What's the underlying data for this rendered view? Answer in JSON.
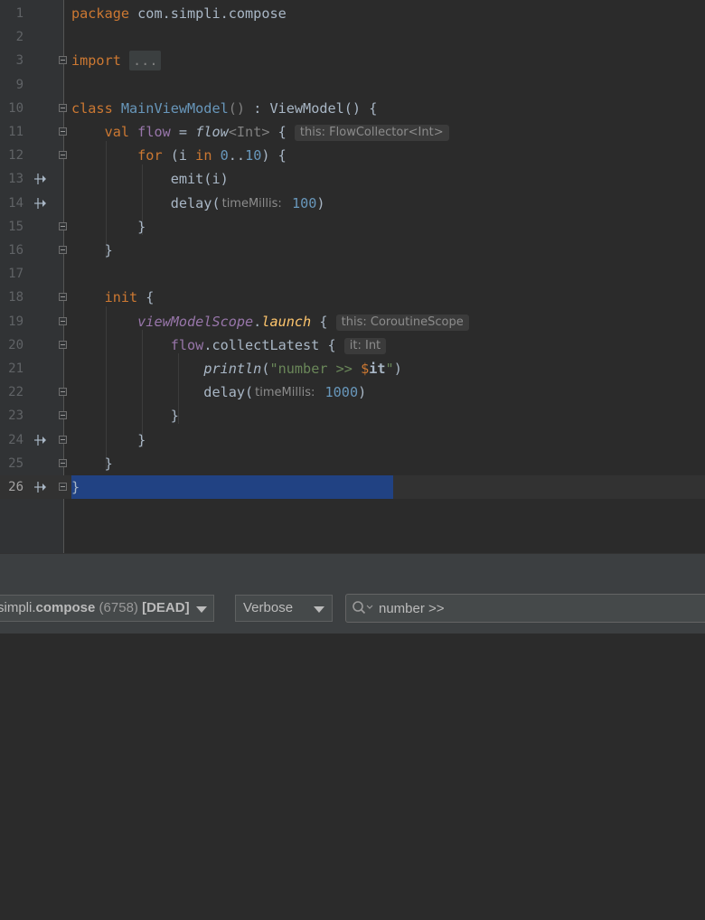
{
  "editor": {
    "lines": [
      {
        "num": "1",
        "tokens": [
          {
            "t": "package",
            "c": "kw"
          },
          {
            "t": " com.simpli.compose"
          }
        ]
      },
      {
        "num": "2",
        "tokens": []
      },
      {
        "num": "3",
        "tokens": [
          {
            "t": "import",
            "c": "kw"
          },
          {
            "t": " "
          },
          {
            "t": "...",
            "c": "ellipsis"
          }
        ]
      },
      {
        "num": "9",
        "tokens": []
      },
      {
        "num": "10",
        "tokens": [
          {
            "t": "class",
            "c": "kw"
          },
          {
            "t": " "
          },
          {
            "t": "MainViewModel",
            "c": "cls"
          },
          {
            "t": "()",
            "c": "gray"
          },
          {
            "t": " : ViewModel() {"
          }
        ]
      },
      {
        "num": "11",
        "tokens": [
          {
            "t": "    "
          },
          {
            "t": "val",
            "c": "kw"
          },
          {
            "t": " "
          },
          {
            "t": "flow",
            "c": "prop"
          },
          {
            "t": " = "
          },
          {
            "t": "flow",
            "c": "fn-it"
          },
          {
            "t": "<Int>",
            "c": "gen"
          },
          {
            "t": " { "
          },
          {
            "t": "this: FlowCollector<Int>",
            "c": "hint"
          }
        ]
      },
      {
        "num": "12",
        "tokens": [
          {
            "t": "        "
          },
          {
            "t": "for",
            "c": "kw"
          },
          {
            "t": " (i "
          },
          {
            "t": "in",
            "c": "kw"
          },
          {
            "t": " "
          },
          {
            "t": "0",
            "c": "num"
          },
          {
            "t": ".."
          },
          {
            "t": "10",
            "c": "num"
          },
          {
            "t": ") {"
          }
        ]
      },
      {
        "num": "13",
        "tokens": [
          {
            "t": "            emit(i)"
          }
        ]
      },
      {
        "num": "14",
        "tokens": [
          {
            "t": "            delay("
          },
          {
            "t": "timeMillis:",
            "c": "hint-c"
          },
          {
            "t": " "
          },
          {
            "t": "100",
            "c": "num"
          },
          {
            "t": ")"
          }
        ]
      },
      {
        "num": "15",
        "tokens": [
          {
            "t": "        }"
          }
        ]
      },
      {
        "num": "16",
        "tokens": [
          {
            "t": "    }"
          }
        ]
      },
      {
        "num": "17",
        "tokens": []
      },
      {
        "num": "18",
        "tokens": [
          {
            "t": "    "
          },
          {
            "t": "init",
            "c": "kw"
          },
          {
            "t": " {"
          }
        ]
      },
      {
        "num": "19",
        "tokens": [
          {
            "t": "        "
          },
          {
            "t": "viewModelScope",
            "c": "prop-it"
          },
          {
            "t": "."
          },
          {
            "t": "launch",
            "c": "fn-y"
          },
          {
            "t": " { "
          },
          {
            "t": "this: CoroutineScope",
            "c": "hint"
          }
        ]
      },
      {
        "num": "20",
        "tokens": [
          {
            "t": "            "
          },
          {
            "t": "flow",
            "c": "prop"
          },
          {
            "t": ".collectLatest { "
          },
          {
            "t": "it: Int",
            "c": "hint"
          }
        ]
      },
      {
        "num": "21",
        "tokens": [
          {
            "t": "                "
          },
          {
            "t": "println",
            "c": "fn-it"
          },
          {
            "t": "("
          },
          {
            "t": "\"number >> ",
            "c": "str"
          },
          {
            "t": "$",
            "c": "kw"
          },
          {
            "t": "it",
            "c": "b"
          },
          {
            "t": "\"",
            "c": "str"
          },
          {
            "t": ")"
          }
        ]
      },
      {
        "num": "22",
        "tokens": [
          {
            "t": "                delay("
          },
          {
            "t": "timeMillis:",
            "c": "hint-c"
          },
          {
            "t": " "
          },
          {
            "t": "1000",
            "c": "num"
          },
          {
            "t": ")"
          }
        ]
      },
      {
        "num": "23",
        "tokens": [
          {
            "t": "            }"
          }
        ]
      },
      {
        "num": "24",
        "tokens": [
          {
            "t": "        }"
          }
        ]
      },
      {
        "num": "25",
        "tokens": [
          {
            "t": "    }"
          }
        ]
      },
      {
        "num": "26",
        "tokens": [
          {
            "t": "}"
          }
        ]
      }
    ]
  },
  "logcat": {
    "process_prefix": "simpli.",
    "process_name": "compose",
    "process_pid": "(6758)",
    "process_state": "[DEAD]",
    "level": "Verbose",
    "filter_value": "number >>"
  },
  "icons": {
    "breakpoint": "step-into-icon",
    "fold": "fold-icon",
    "search": "search-icon",
    "dropdown": "chevron-down-icon"
  },
  "colors": {
    "selection": "#214283",
    "keyword": "#cc7832",
    "number": "#6897bb",
    "string": "#6a8759"
  }
}
